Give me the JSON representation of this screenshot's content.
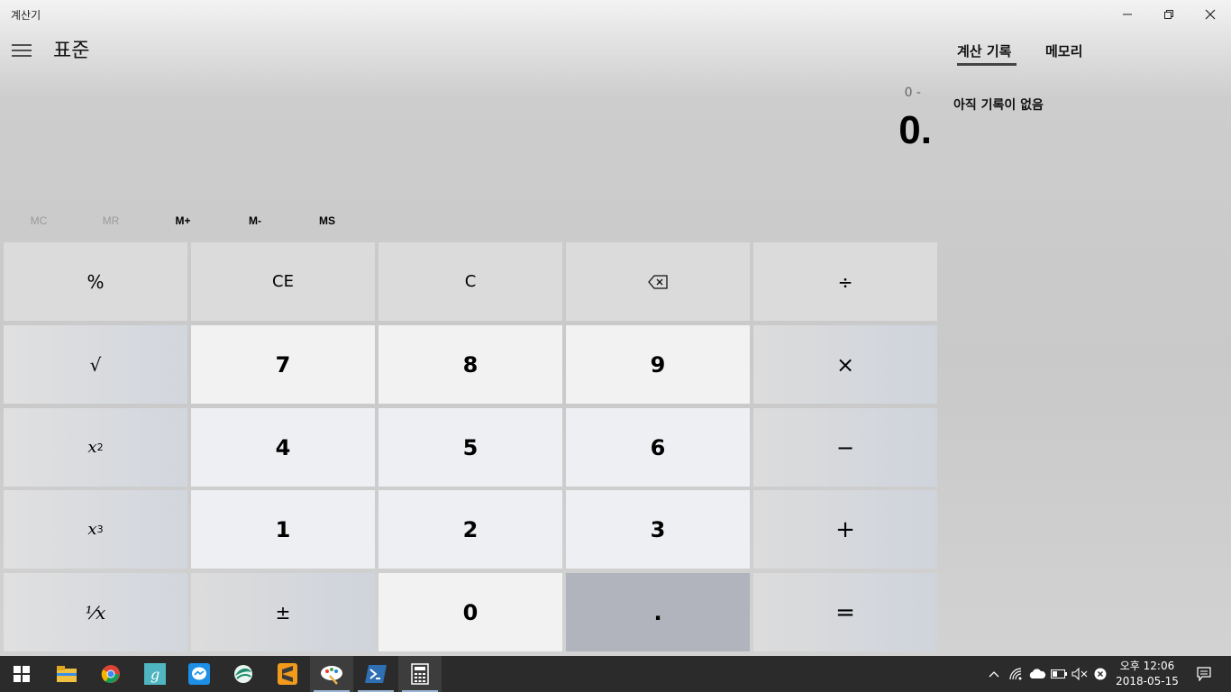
{
  "window": {
    "title": "계산기",
    "mode": "표준"
  },
  "display": {
    "expression": "0 -",
    "result": "0."
  },
  "memory": {
    "mc": "MC",
    "mr": "MR",
    "mplus": "M+",
    "mminus": "M-",
    "ms": "MS"
  },
  "keys": {
    "percent": "%",
    "ce": "CE",
    "c": "C",
    "divide": "÷",
    "sqrt": "√",
    "seven": "7",
    "eight": "8",
    "nine": "9",
    "multiply": "×",
    "square_base": "x",
    "square_exp": "2",
    "four": "4",
    "five": "5",
    "six": "6",
    "minus": "−",
    "cube_base": "x",
    "cube_exp": "3",
    "one": "1",
    "two": "2",
    "three": "3",
    "plus": "+",
    "reciprocal": "⅟x",
    "negate": "±",
    "zero": "0",
    "dot": ".",
    "equals": "="
  },
  "history": {
    "tab_history": "계산 기록",
    "tab_memory": "메모리",
    "empty": "아직 기록이 없음"
  },
  "taskbar": {
    "apps": [
      "windows-start",
      "file-explorer",
      "chrome",
      "grammarly",
      "messenger",
      "app-swirl",
      "sublime-text",
      "paint-app",
      "powershell",
      "calculator"
    ],
    "time": "오후 12:06",
    "date": "2018-05-15"
  },
  "colors": {
    "taskbar": "#2b2b2b",
    "accent_underline": "#444444",
    "pressed_key": "#b1b4bc"
  }
}
